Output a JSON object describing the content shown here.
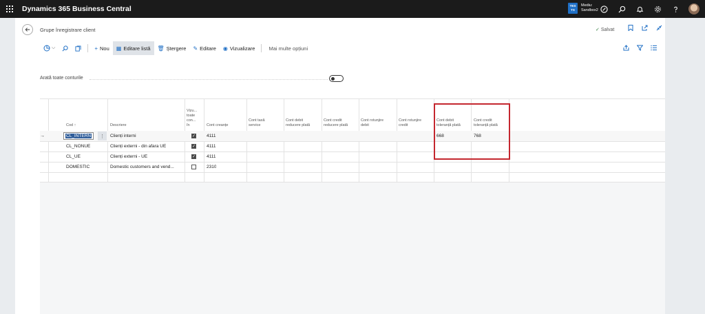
{
  "app": {
    "title": "Dynamics 365 Business Central"
  },
  "environment": {
    "badge_line1": "TES",
    "badge_line2": "TS",
    "line1": "Mediu:",
    "line2": "Sandbox2"
  },
  "page": {
    "title": "Grupe înregistrare client",
    "saved": "Salvat"
  },
  "toolbar": {
    "new": "Nou",
    "edit_list": "Editare listă",
    "delete": "Ștergere",
    "edit": "Editare",
    "view": "Vizualizare",
    "more": "Mai multe opțiuni"
  },
  "filter": {
    "show_all_label": "Arată toate conturile"
  },
  "columns": {
    "code": "Cod ↑",
    "description": "Descriere",
    "view_all_line1": "Vizu...",
    "view_all_line2": "toate",
    "view_all_line3": "con...",
    "view_all_line4": "în",
    "receivables": "Cont creanțe",
    "service_charge_line1": "Cont taxă",
    "service_charge_line2": "service",
    "pmt_disc_debit_line1": "Cont debit",
    "pmt_disc_debit_line2": "reducere plată",
    "pmt_disc_credit_line1": "Cont credit",
    "pmt_disc_credit_line2": "reducere plată",
    "rounding_debit_line1": "Cont rotunjire",
    "rounding_debit_line2": "debit",
    "rounding_credit_line1": "Cont rotunjire",
    "rounding_credit_line2": "credit",
    "pmt_tol_debit_line1": "Cont debit",
    "pmt_tol_debit_line2": "toleranță plată",
    "pmt_tol_credit_line1": "Cont credit",
    "pmt_tol_credit_line2": "toleranță plată"
  },
  "rows": [
    {
      "code": "CL_INTERN",
      "description": "Clienți interni",
      "view_all": true,
      "receivables": "4111",
      "pmt_tol_debit": "668",
      "pmt_tol_credit": "768"
    },
    {
      "code": "CL_NONUE",
      "description": "Clienți externi - din afara UE",
      "view_all": true,
      "receivables": "4111",
      "pmt_tol_debit": "",
      "pmt_tol_credit": ""
    },
    {
      "code": "CL_UE",
      "description": "Clienți externi  - UE",
      "view_all": true,
      "receivables": "4111",
      "pmt_tol_debit": "",
      "pmt_tol_credit": ""
    },
    {
      "code": "DOMESTIC",
      "description": "Domestic customers and vend...",
      "view_all": false,
      "receivables": "2310",
      "pmt_tol_debit": "",
      "pmt_tol_credit": ""
    }
  ],
  "colors": {
    "accent": "#1f6fc5",
    "highlight": "#c4262e",
    "topbar": "#1b1b1b"
  }
}
